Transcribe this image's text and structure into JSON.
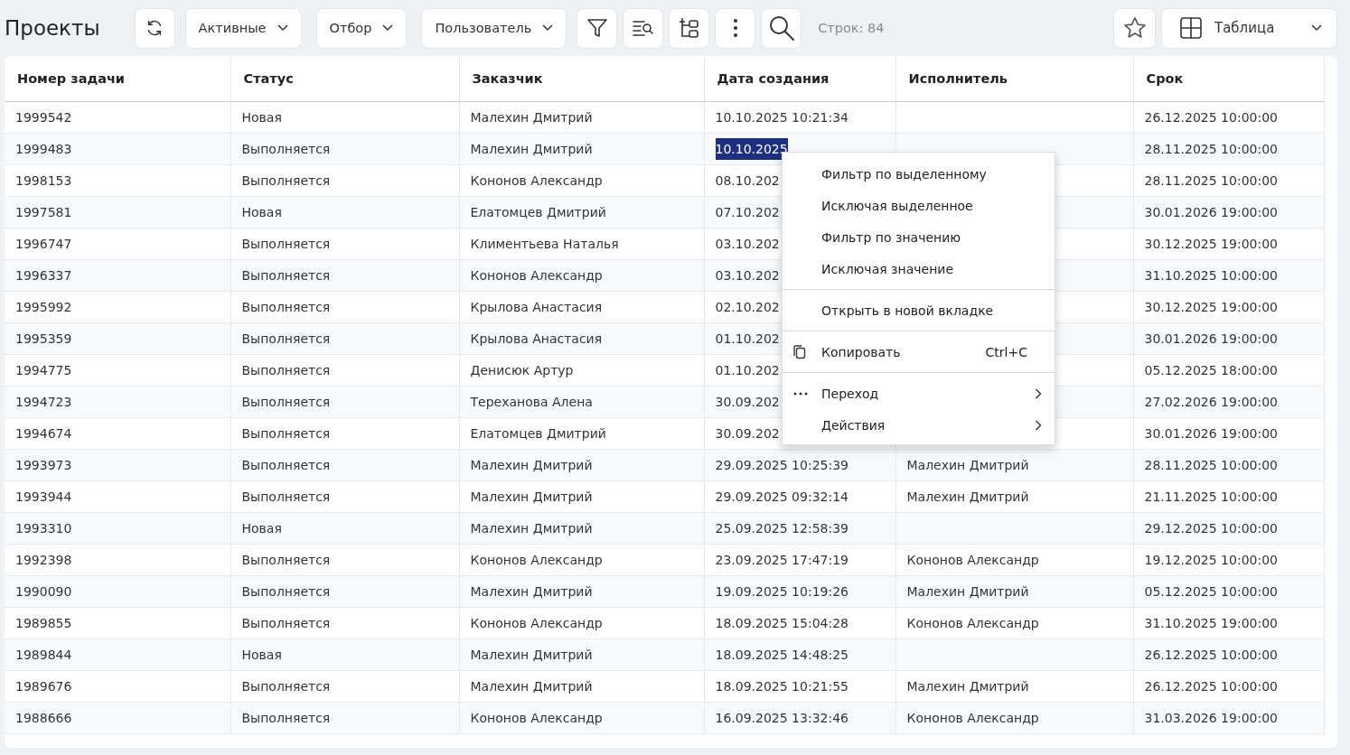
{
  "title": "Проекты",
  "toolbar": [
    {
      "kind": "icon"
    },
    {
      "kind": "dropdown",
      "label": "Активные"
    },
    {
      "kind": "dropdown",
      "label": "Отбор"
    },
    {
      "kind": "dropdown",
      "label": "Пользователь"
    },
    {
      "kind": "icon"
    },
    {
      "kind": "icon"
    },
    {
      "kind": "icon"
    },
    {
      "kind": "icon"
    },
    {
      "kind": "icon"
    }
  ],
  "row_count": "Строк: 84",
  "view": {
    "label": "Таблица"
  },
  "table": {
    "columns": [
      "Номер задачи",
      "Статус",
      "Заказчик",
      "Дата создания",
      "Исполнитель",
      "Срок"
    ],
    "rows": [
      [
        "1999542",
        "Новая",
        "Малехин Дмитрий",
        "10.10.2025 10:21:34",
        null,
        "26.12.2025 10:00:00"
      ],
      [
        "1999483",
        "Выполняется",
        "Малехин Дмитрий",
        {
          "selected": "10.10.2025"
        },
        null,
        "28.11.2025 10:00:00"
      ],
      [
        "1998153",
        "Выполняется",
        "Кононов Александр",
        "08.10.202",
        null,
        "28.11.2025 10:00:00"
      ],
      [
        "1997581",
        "Новая",
        "Елатомцев Дмитрий",
        "07.10.202",
        null,
        "30.01.2026 19:00:00"
      ],
      [
        "1996747",
        "Выполняется",
        "Климентьева Наталья",
        "03.10.202",
        null,
        "30.12.2025 19:00:00"
      ],
      [
        "1996337",
        "Выполняется",
        "Кононов Александр",
        "03.10.202",
        null,
        "31.10.2025 10:00:00"
      ],
      [
        "1995992",
        "Выполняется",
        "Крылова Анастасия",
        "02.10.202",
        null,
        "30.12.2025 19:00:00"
      ],
      [
        "1995359",
        "Выполняется",
        "Крылова Анастасия",
        "01.10.202",
        null,
        "30.01.2026 19:00:00"
      ],
      [
        "1994775",
        "Выполняется",
        "Денисюк Артур",
        "01.10.202",
        null,
        "05.12.2025 18:00:00"
      ],
      [
        "1994723",
        "Выполняется",
        "Тереханова Алена",
        "30.09.202",
        null,
        "27.02.2026 19:00:00"
      ],
      [
        "1994674",
        "Выполняется",
        "Елатомцев Дмитрий",
        "30.09.202",
        null,
        "30.01.2026 19:00:00"
      ],
      [
        "1993973",
        "Выполняется",
        "Малехин Дмитрий",
        "29.09.2025 10:25:39",
        "Малехин Дмитрий",
        "28.11.2025 10:00:00"
      ],
      [
        "1993944",
        "Выполняется",
        "Малехин Дмитрий",
        "29.09.2025 09:32:14",
        "Малехин Дмитрий",
        "21.11.2025 10:00:00"
      ],
      [
        "1993310",
        "Новая",
        "Малехин Дмитрий",
        "25.09.2025 12:58:39",
        null,
        "29.12.2025 10:00:00"
      ],
      [
        "1992398",
        "Выполняется",
        "Кононов Александр",
        "23.09.2025 17:47:19",
        "Кононов Александр",
        "19.12.2025 10:00:00"
      ],
      [
        "1990090",
        "Выполняется",
        "Малехин Дмитрий",
        "19.09.2025 10:19:26",
        "Малехин Дмитрий",
        "05.12.2025 10:00:00"
      ],
      [
        "1989855",
        "Выполняется",
        "Кононов Александр",
        "18.09.2025 15:04:28",
        "Кононов Александр",
        "31.10.2025 19:00:00"
      ],
      [
        "1989844",
        "Новая",
        "Малехин Дмитрий",
        "18.09.2025 14:48:25",
        null,
        "26.12.2025 10:00:00"
      ],
      [
        "1989676",
        "Выполняется",
        "Малехин Дмитрий",
        "18.09.2025 10:21:55",
        "Малехин Дмитрий",
        "26.12.2025 10:00:00"
      ],
      [
        "1988666",
        "Выполняется",
        "Кононов Александр",
        "16.09.2025 13:32:46",
        "Кононов Александр",
        "31.03.2026 19:00:00"
      ]
    ]
  },
  "context_menu": [
    {
      "kind": "item",
      "label": "Фильтр по выделенному"
    },
    {
      "kind": "item",
      "label": "Исключая выделенное"
    },
    {
      "kind": "item",
      "label": "Фильтр по значению"
    },
    {
      "kind": "item",
      "label": "Исключая значение"
    },
    {
      "kind": "separator"
    },
    {
      "kind": "item",
      "label": "Открыть в новой вкладке"
    },
    {
      "kind": "separator"
    },
    {
      "kind": "item",
      "label": "Копировать",
      "shortcut": "Ctrl+C"
    },
    {
      "kind": "separator"
    },
    {
      "kind": "submenu",
      "label": "Переход"
    },
    {
      "kind": "submenu",
      "label": "Действия"
    }
  ]
}
